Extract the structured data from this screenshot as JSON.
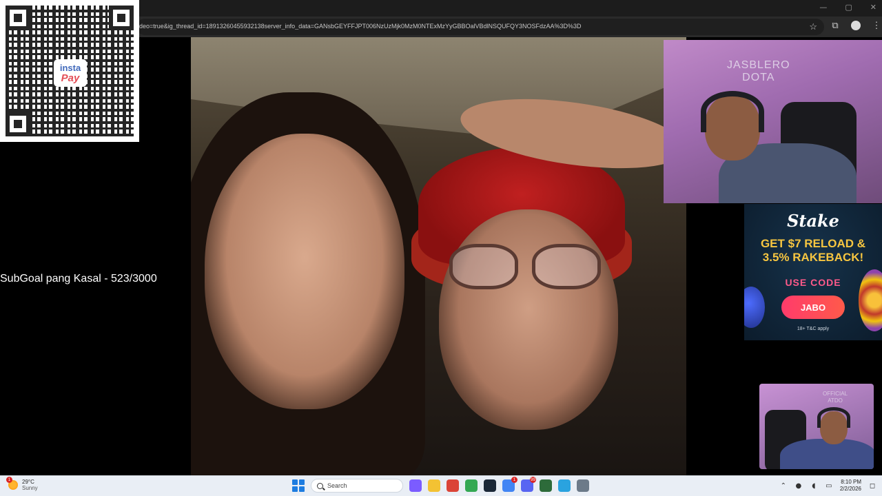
{
  "browser": {
    "url": "deo=true&ig_thread_id=18913260455932138server_info_data=GANsbGEYFFJPT006NzUzMjk0MzM0NTExMzYyGBBOalVBdlNSQUFQY3NOSFdzAA%3D%3D",
    "window_controls": [
      "—",
      "▢",
      "✕"
    ]
  },
  "qr": {
    "logo_line1": "insta",
    "logo_line2": "Pay"
  },
  "overlay": {
    "subgoal_text": "SubGoal pang Kasal - 523/3000"
  },
  "webcam": {
    "neon_line1": "JASBLERO",
    "neon_line2": "DOTA"
  },
  "ad": {
    "brand": "Stake",
    "headline_line1": "GET $7 RELOAD &",
    "headline_line2": "3.5% RAKEBACK!",
    "code_label": "USE CODE",
    "code": "JABO",
    "fine_print": "18+ T&C apply"
  },
  "webcam_small": {
    "neon_line1": "OFFICIAL",
    "neon_line2": "ATDO"
  },
  "taskbar": {
    "weather_temp": "29°C",
    "weather_desc": "Sunny",
    "weather_badge": "1",
    "search_placeholder": "Search",
    "time": "8:10 PM",
    "date": "2/2/2026",
    "apps": [
      {
        "name": "copilot-icon",
        "color": "#7b5cff"
      },
      {
        "name": "file-explorer-icon",
        "color": "#f3c233"
      },
      {
        "name": "chrome-icon",
        "color": "#db4437"
      },
      {
        "name": "chrome-icon-2",
        "color": "#34a853"
      },
      {
        "name": "steam-icon",
        "color": "#1b2838"
      },
      {
        "name": "chrome-icon-3",
        "color": "#4285f4",
        "badge": "1"
      },
      {
        "name": "discord-icon",
        "color": "#5865f2",
        "badge": "99"
      },
      {
        "name": "app-icon",
        "color": "#2d6b3a"
      },
      {
        "name": "telegram-icon",
        "color": "#2aa3df"
      },
      {
        "name": "tool-icon",
        "color": "#6c7a89"
      }
    ]
  }
}
